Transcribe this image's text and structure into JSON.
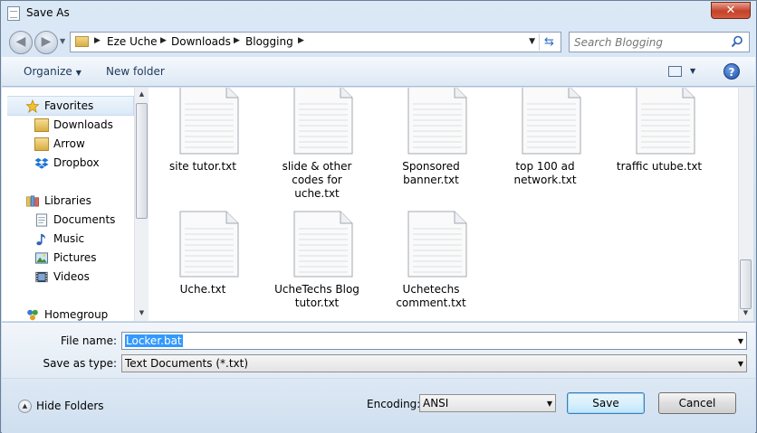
{
  "window": {
    "title": "Save As"
  },
  "address": {
    "crumbs": [
      "Eze Uche",
      "Downloads",
      "Blogging"
    ]
  },
  "search": {
    "placeholder": "Search Blogging"
  },
  "toolbar": {
    "organize_label": "Organize",
    "new_folder_label": "New folder"
  },
  "sidebar": {
    "favorites": {
      "label": "Favorites",
      "items": [
        {
          "label": "Downloads",
          "icon": "folder-icon"
        },
        {
          "label": "Arrow",
          "icon": "folder-icon"
        },
        {
          "label": "Dropbox",
          "icon": "dropbox-icon"
        }
      ]
    },
    "libraries": {
      "label": "Libraries",
      "items": [
        {
          "label": "Documents",
          "icon": "documents-icon"
        },
        {
          "label": "Music",
          "icon": "music-icon"
        },
        {
          "label": "Pictures",
          "icon": "pictures-icon"
        },
        {
          "label": "Videos",
          "icon": "videos-icon"
        }
      ]
    },
    "homegroup": {
      "label": "Homegroup"
    }
  },
  "files": [
    {
      "line1": "site tutor.txt",
      "line2": "",
      "line3": ""
    },
    {
      "line1": "slide & other",
      "line2": "codes for",
      "line3": "uche.txt"
    },
    {
      "line1": "Sponsored",
      "line2": "banner.txt",
      "line3": ""
    },
    {
      "line1": "top 100 ad",
      "line2": "network.txt",
      "line3": ""
    },
    {
      "line1": "traffic utube.txt",
      "line2": "",
      "line3": ""
    },
    {
      "line1": "Uche.txt",
      "line2": "",
      "line3": ""
    },
    {
      "line1": "UcheTechs Blog",
      "line2": "tutor.txt",
      "line3": ""
    },
    {
      "line1": "Uchetechs",
      "line2": "comment.txt",
      "line3": ""
    }
  ],
  "form": {
    "file_name_label": "File name:",
    "file_name_value": "Locker.bat",
    "save_type_label": "Save as type:",
    "save_type_value": "Text Documents (*.txt)"
  },
  "footer": {
    "hide_folders_label": "Hide Folders",
    "encoding_label": "Encoding:",
    "encoding_value": "ANSI",
    "save_label": "Save",
    "cancel_label": "Cancel"
  },
  "colors": {
    "accent": "#3399ff",
    "close_button": "#c4412a",
    "link_text": "#1e395b"
  }
}
